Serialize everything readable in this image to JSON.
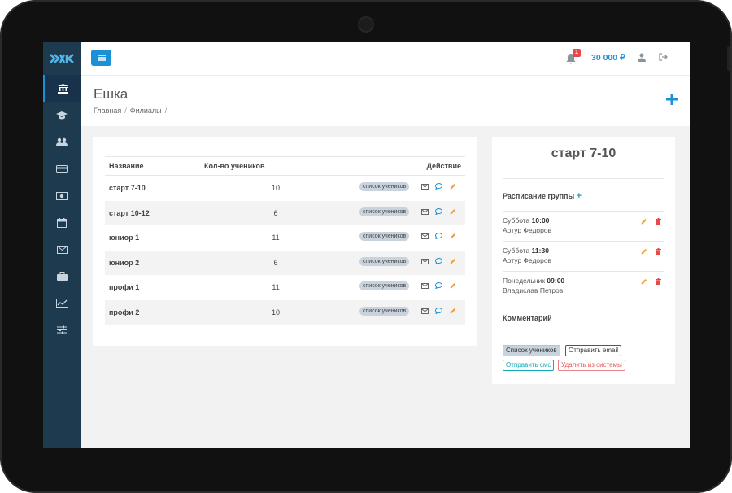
{
  "app": {
    "balance": "30 000 ₽",
    "notification_count": "1",
    "accent": "#1d8fd6",
    "sidebar_bg": "#1d3a4f"
  },
  "sidebar": {
    "items": [
      {
        "icon": "bank-icon",
        "active": true
      },
      {
        "icon": "graduation-cap-icon",
        "active": false
      },
      {
        "icon": "users-icon",
        "active": false
      },
      {
        "icon": "credit-card-icon",
        "active": false
      },
      {
        "icon": "money-icon",
        "active": false
      },
      {
        "icon": "calendar-icon",
        "active": false
      },
      {
        "icon": "envelope-icon",
        "active": false
      },
      {
        "icon": "briefcase-icon",
        "active": false
      },
      {
        "icon": "line-chart-icon",
        "active": false
      },
      {
        "icon": "sliders-icon",
        "active": false
      }
    ]
  },
  "header": {
    "title": "Ешка",
    "breadcrumb": [
      "Главная",
      "Филиалы"
    ]
  },
  "groups_table": {
    "columns": [
      "Название",
      "Кол-во учеников",
      "Действие"
    ],
    "rows": [
      {
        "name": "старт 7-10",
        "count": "10",
        "action_label": "список учеников"
      },
      {
        "name": "старт 10-12",
        "count": "6",
        "action_label": "список учеников"
      },
      {
        "name": "юниор 1",
        "count": "11",
        "action_label": "список учеников"
      },
      {
        "name": "юниор 2",
        "count": "6",
        "action_label": "список учеников"
      },
      {
        "name": "профи 1",
        "count": "11",
        "action_label": "список учеников"
      },
      {
        "name": "профи 2",
        "count": "10",
        "action_label": "список учеников"
      }
    ]
  },
  "group_detail": {
    "title": "старт 7-10",
    "schedule_title": "Расписание группы",
    "schedule": [
      {
        "day": "Суббота",
        "time": "10:00",
        "teacher": "Артур Федоров"
      },
      {
        "day": "Суббота",
        "time": "11:30",
        "teacher": "Артур Федоров"
      },
      {
        "day": "Понедельник",
        "time": "09:00",
        "teacher": "Владислав Петров"
      }
    ],
    "comment_title": "Комментарий",
    "buttons": {
      "students_list": "Список учеников",
      "send_email": "Отправить email",
      "send_sms": "Отправить смс",
      "delete": "Удалить из системы"
    }
  }
}
